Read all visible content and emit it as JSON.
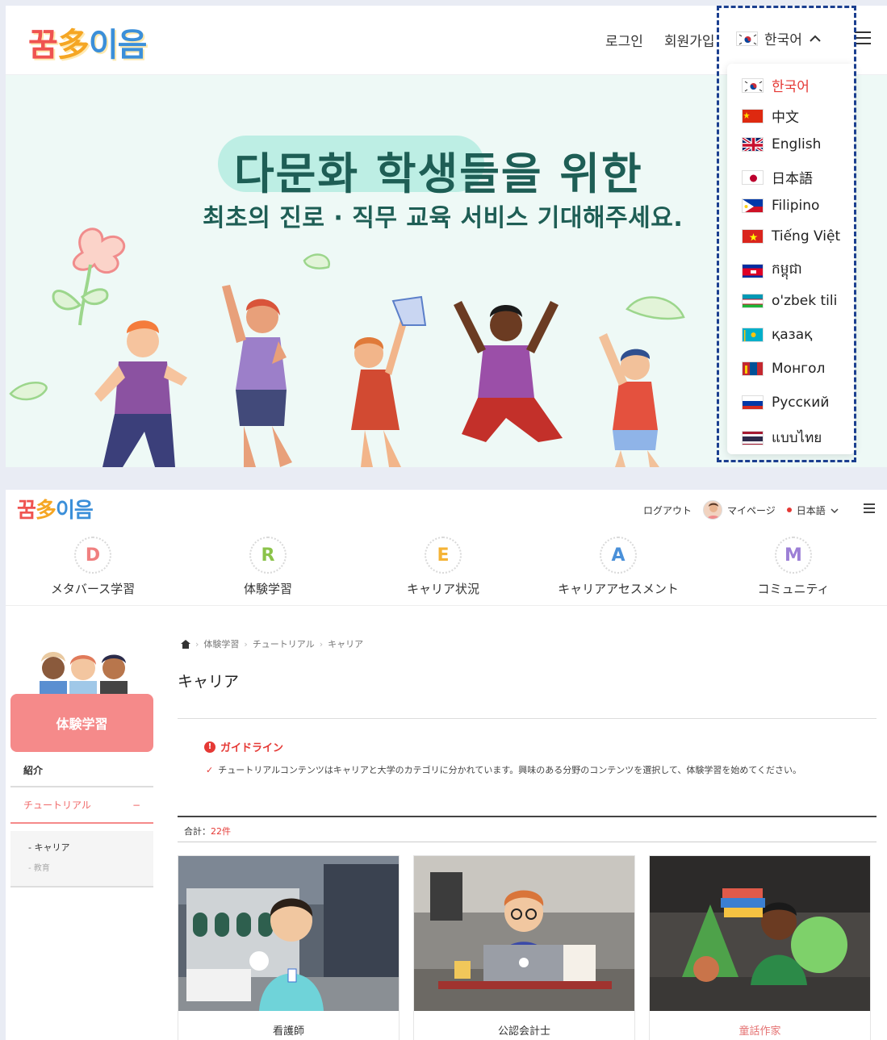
{
  "panel1": {
    "logo": {
      "part1": "꿈",
      "part2": "多",
      "part3": "이음"
    },
    "nav": {
      "login": "로그인",
      "signup": "회원가입",
      "lang": "한국어"
    },
    "hero": {
      "title": "다문화 학생들을 위한",
      "subtitle": "최초의 진로 · 직무 교육 서비스 기대해주세요."
    },
    "languages": [
      {
        "label": "한국어",
        "flag": "kr",
        "active": true
      },
      {
        "label": "中文",
        "flag": "cn"
      },
      {
        "label": "English",
        "flag": "gb"
      },
      {
        "label": "日本語",
        "flag": "jp"
      },
      {
        "label": "Filipino",
        "flag": "ph"
      },
      {
        "label": "Tiếng Việt",
        "flag": "vn"
      },
      {
        "label": "កម្ពុជា",
        "flag": "kh"
      },
      {
        "label": "o'zbek tili",
        "flag": "uz"
      },
      {
        "label": "қазақ",
        "flag": "kz"
      },
      {
        "label": "Монгол",
        "flag": "mn"
      },
      {
        "label": "Русский",
        "flag": "ru"
      },
      {
        "label": "แบบไทย",
        "flag": "th"
      }
    ]
  },
  "panel2": {
    "logo": {
      "part1": "꿈",
      "part2": "多",
      "part3": "이음"
    },
    "topnav": {
      "logout": "ログアウト",
      "mypage": "マイページ",
      "lang": "日本語"
    },
    "menu": [
      {
        "letter": "D",
        "label": "メタバース学習",
        "color": "#f08080"
      },
      {
        "letter": "R",
        "label": "体験学習",
        "color": "#8bc34a"
      },
      {
        "letter": "E",
        "label": "キャリア状況",
        "color": "#f5b335"
      },
      {
        "letter": "A",
        "label": "キャリアアセスメント",
        "color": "#4a90d9"
      },
      {
        "letter": "M",
        "label": "コミュニティ",
        "color": "#9c7fd6"
      }
    ],
    "sidebar": {
      "title": "体験学習",
      "intro": "紹介",
      "tutorial": "チュートリアル",
      "tutorial_toggle": "−",
      "sub": [
        "- キャリア",
        "- 教育"
      ]
    },
    "breadcrumb": [
      "体験学習",
      "チュートリアル",
      "キャリア"
    ],
    "page_title": "キャリア",
    "guide": {
      "title": "ガイドライン",
      "text": "チュートリアルコンテンツはキャリアと大学のカテゴリに分かれています。興味のある分野のコンテンツを選択して、体験学習を始めてください。"
    },
    "total": {
      "label": "合計：",
      "count": "22件"
    },
    "cards": [
      {
        "label": "看護師"
      },
      {
        "label": "公認会計士"
      },
      {
        "label": "童話作家"
      }
    ]
  }
}
